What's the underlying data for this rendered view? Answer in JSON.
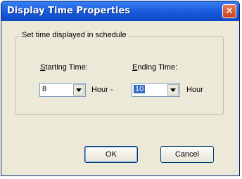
{
  "window": {
    "title": "Display Time Properties",
    "close_glyph": "✕"
  },
  "group": {
    "label": "Set time displayed in schedule"
  },
  "starting": {
    "label_prefix": "",
    "label_accel": "S",
    "label_rest": "tarting Time:",
    "value": "8",
    "unit": "Hour -"
  },
  "ending": {
    "label_prefix": "",
    "label_accel": "E",
    "label_rest": "nding Time:",
    "value": "10",
    "unit": "Hour"
  },
  "buttons": {
    "ok": "OK",
    "cancel": "Cancel"
  },
  "icons": {
    "close": "close-icon",
    "dropdown": "chevron-down-icon"
  },
  "colors": {
    "titlebar": "#1b5fe0",
    "close": "#d95a34",
    "selection": "#316ac5",
    "window_bg": "#ece9d8"
  }
}
